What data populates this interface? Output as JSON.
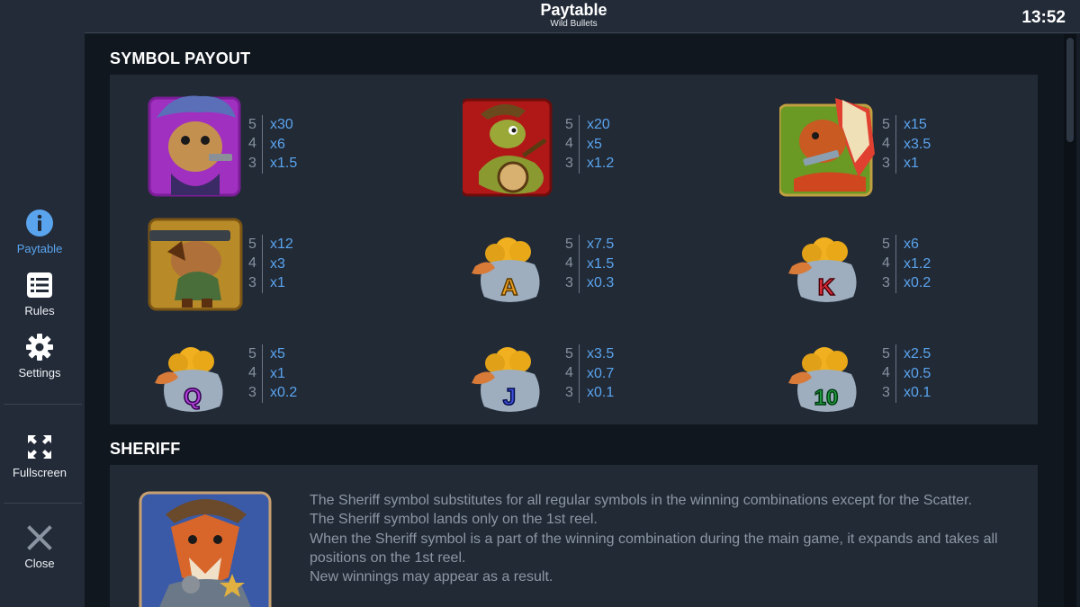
{
  "header": {
    "title": "Paytable",
    "subtitle": "Wild Bullets",
    "time": "13:52"
  },
  "nav": {
    "paytable": "Paytable",
    "rules": "Rules",
    "settings": "Settings",
    "fullscreen": "Fullscreen",
    "close": "Close"
  },
  "symbol_payout": {
    "title": "SYMBOL PAYOUT",
    "symbols": [
      {
        "icon": "cat-cowgirl-icon",
        "counts": [
          "5",
          "4",
          "3"
        ],
        "values": [
          "x30",
          "x6",
          "x1.5"
        ]
      },
      {
        "icon": "snake-banjo-icon",
        "counts": [
          "5",
          "4",
          "3"
        ],
        "values": [
          "x20",
          "x5",
          "x1.2"
        ]
      },
      {
        "icon": "bison-chief-icon",
        "counts": [
          "5",
          "4",
          "3"
        ],
        "values": [
          "x15",
          "x3.5",
          "x1"
        ]
      },
      {
        "icon": "bulldog-gunner-icon",
        "counts": [
          "5",
          "4",
          "3"
        ],
        "values": [
          "x12",
          "x3",
          "x1"
        ]
      },
      {
        "icon": "money-bag-a-icon",
        "letter": "A",
        "color": "#f0a020",
        "counts": [
          "5",
          "4",
          "3"
        ],
        "values": [
          "x7.5",
          "x1.5",
          "x0.3"
        ]
      },
      {
        "icon": "money-bag-k-icon",
        "letter": "K",
        "color": "#e0303a",
        "counts": [
          "5",
          "4",
          "3"
        ],
        "values": [
          "x6",
          "x1.2",
          "x0.2"
        ]
      },
      {
        "icon": "money-bag-q-icon",
        "letter": "Q",
        "color": "#b040d8",
        "counts": [
          "5",
          "4",
          "3"
        ],
        "values": [
          "x5",
          "x1",
          "x0.2"
        ]
      },
      {
        "icon": "money-bag-j-icon",
        "letter": "J",
        "color": "#4050d8",
        "counts": [
          "5",
          "4",
          "3"
        ],
        "values": [
          "x3.5",
          "x0.7",
          "x0.1"
        ]
      },
      {
        "icon": "money-bag-10-icon",
        "letter": "10",
        "color": "#20a040",
        "counts": [
          "5",
          "4",
          "3"
        ],
        "values": [
          "x2.5",
          "x0.5",
          "x0.1"
        ]
      }
    ]
  },
  "sheriff": {
    "title": "SHERIFF",
    "icon": "sheriff-fox-icon",
    "lines": [
      "The Sheriff symbol substitutes for all regular symbols in the winning combinations except for the Scatter.",
      "The Sheriff symbol lands only on the 1st reel.",
      "When the Sheriff symbol is a part of the winning combination during the main game, it expands and takes all positions on the 1st reel.",
      "New winnings may appear as a result."
    ]
  },
  "colors": {
    "accent": "#5aa4ee",
    "sidebar": "#232b38",
    "panel": "#222a36",
    "background": "#11171f"
  }
}
